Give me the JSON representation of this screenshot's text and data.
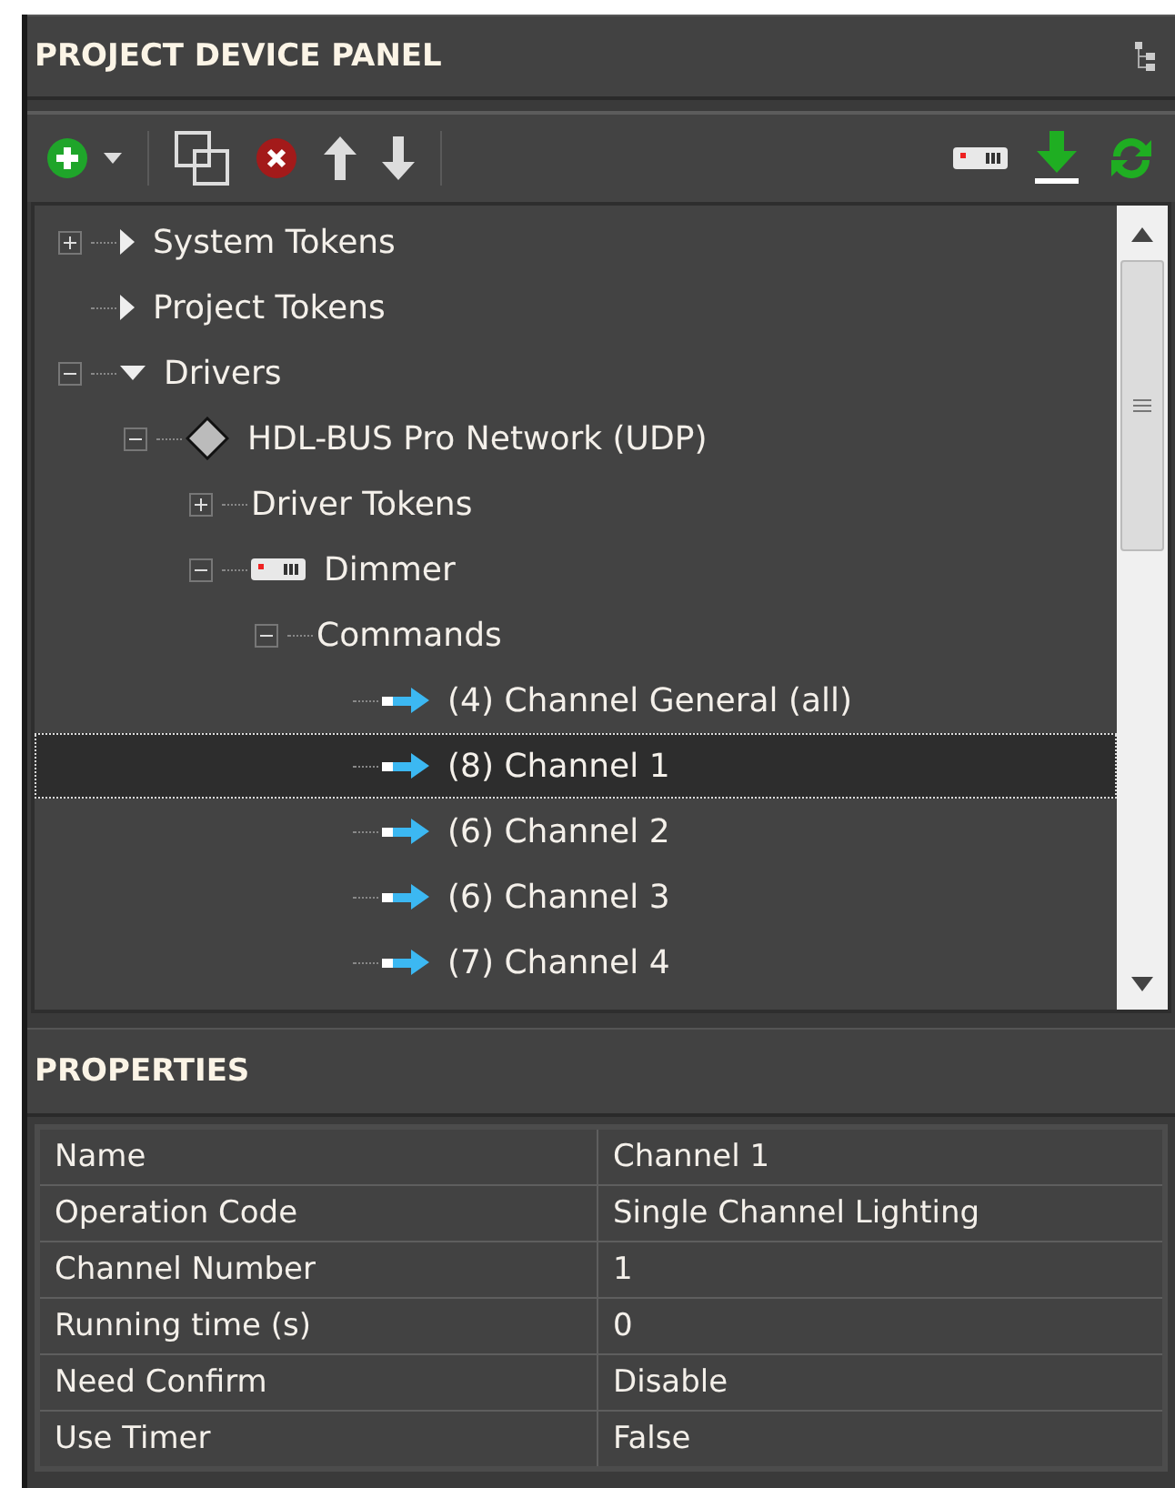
{
  "device_panel": {
    "title": "PROJECT DEVICE PANEL",
    "tree": [
      {
        "label": "System Tokens",
        "kind": "folder",
        "expanded": false
      },
      {
        "label": "Project Tokens",
        "kind": "folder"
      },
      {
        "label": "Drivers",
        "kind": "folder",
        "expanded": true,
        "children": [
          {
            "label": "HDL-BUS Pro Network (UDP)",
            "kind": "network",
            "expanded": true,
            "children": [
              {
                "label": "Driver Tokens",
                "expanded": false
              },
              {
                "label": "Dimmer",
                "kind": "device",
                "expanded": true,
                "children": [
                  {
                    "label": "Commands",
                    "expanded": true,
                    "children": [
                      {
                        "label": "(4) Channel General (all)",
                        "kind": "command",
                        "selected": false
                      },
                      {
                        "label": "(8) Channel 1",
                        "kind": "command",
                        "selected": true
                      },
                      {
                        "label": "(6) Channel 2",
                        "kind": "command",
                        "selected": false
                      },
                      {
                        "label": "(6) Channel 3",
                        "kind": "command",
                        "selected": false
                      },
                      {
                        "label": "(7) Channel 4",
                        "kind": "command",
                        "selected": false
                      }
                    ]
                  }
                ]
              }
            ]
          }
        ]
      }
    ]
  },
  "properties": {
    "title": "PROPERTIES",
    "rows": [
      {
        "name": "Name",
        "value": "Channel 1"
      },
      {
        "name": "Operation Code",
        "value": "Single Channel Lighting"
      },
      {
        "name": "Channel Number",
        "value": "1"
      },
      {
        "name": "Running time (s)",
        "value": "0"
      },
      {
        "name": "Need Confirm",
        "value": "Disable"
      },
      {
        "name": "Use Timer",
        "value": "False"
      }
    ]
  }
}
